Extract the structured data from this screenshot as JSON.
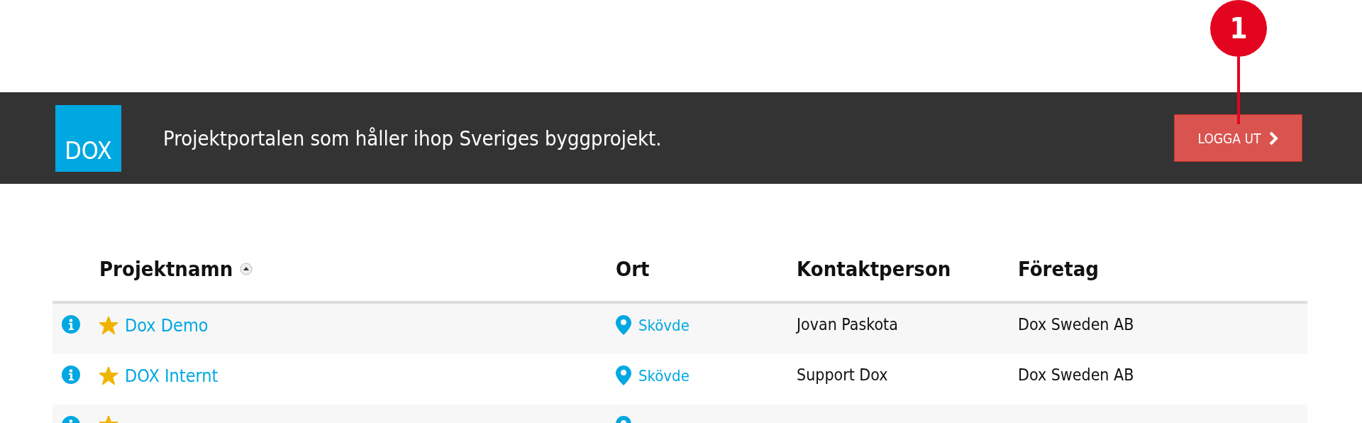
{
  "header": {
    "logo": "DOX",
    "tagline": "Projektportalen som håller ihop Sveriges byggprojekt.",
    "logout_button": "LOGGA UT",
    "callout": "1"
  },
  "table": {
    "columns": [
      {
        "label": "Projektnamn",
        "sorted": true
      },
      {
        "label": "Ort",
        "sorted": false
      },
      {
        "label": "Kontaktperson",
        "sorted": false
      },
      {
        "label": "Företag",
        "sorted": false
      }
    ],
    "rows": [
      {
        "starred": true,
        "name": "Dox Demo",
        "city": "Skövde",
        "contact": "Jovan Paskota",
        "company": "Dox Sweden AB"
      },
      {
        "starred": true,
        "name": "DOX Internt",
        "city": "Skövde",
        "contact": "Support Dox",
        "company": "Dox Sweden AB"
      },
      {
        "starred": true
      }
    ]
  }
}
